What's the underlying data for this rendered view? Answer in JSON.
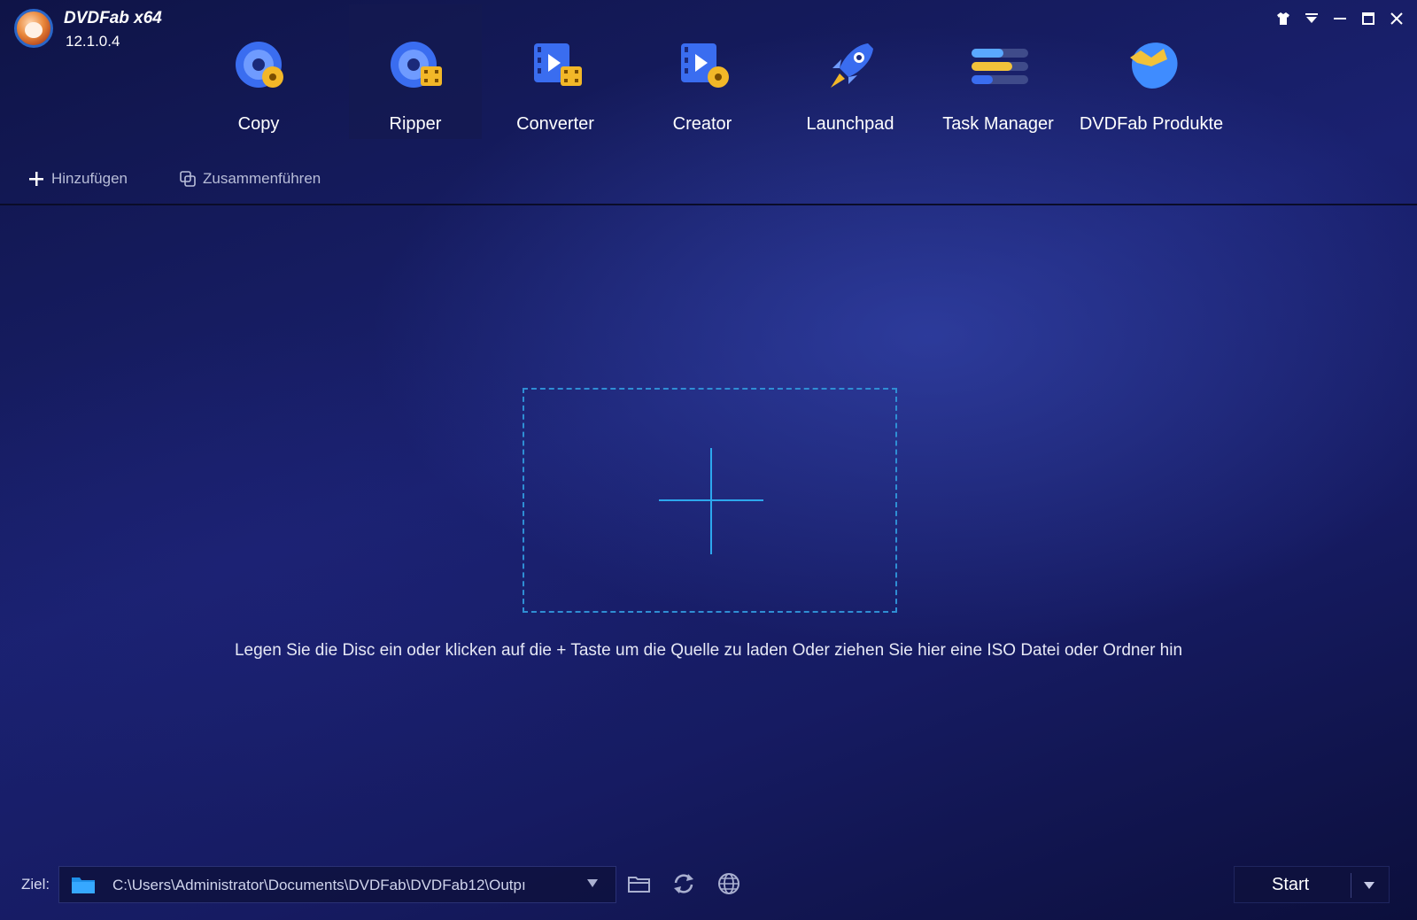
{
  "app": {
    "brand": "DVDFab x64",
    "version": "12.1.0.4"
  },
  "modules": [
    {
      "label": "Copy",
      "icon": "copy-disc-icon",
      "active": false
    },
    {
      "label": "Ripper",
      "icon": "ripper-disc-icon",
      "active": true
    },
    {
      "label": "Converter",
      "icon": "converter-film-icon",
      "active": false
    },
    {
      "label": "Creator",
      "icon": "creator-film-icon",
      "active": false
    },
    {
      "label": "Launchpad",
      "icon": "rocket-icon",
      "active": false
    },
    {
      "label": "Task Manager",
      "icon": "task-list-icon",
      "active": false
    },
    {
      "label": "DVDFab Produkte",
      "icon": "dvdfab-products-icon",
      "active": false
    }
  ],
  "window_controls": [
    "skin-icon",
    "menu-dropdown-icon",
    "minimize-icon",
    "maximize-icon",
    "close-icon"
  ],
  "toolbar": {
    "add_label": "Hinzufügen",
    "merge_label": "Zusammenführen"
  },
  "main": {
    "hint": "Legen Sie die Disc ein oder klicken auf die + Taste um die Quelle zu laden Oder ziehen Sie hier eine ISO Datei oder Ordner hin"
  },
  "bottom": {
    "target_label": "Ziel:",
    "path": "C:\\Users\\Administrator\\Documents\\DVDFab\\DVDFab12\\Outpı",
    "start_label": "Start"
  },
  "colors": {
    "accent": "#2da8ee",
    "background": "#1a2170",
    "text": "#ffffff"
  }
}
